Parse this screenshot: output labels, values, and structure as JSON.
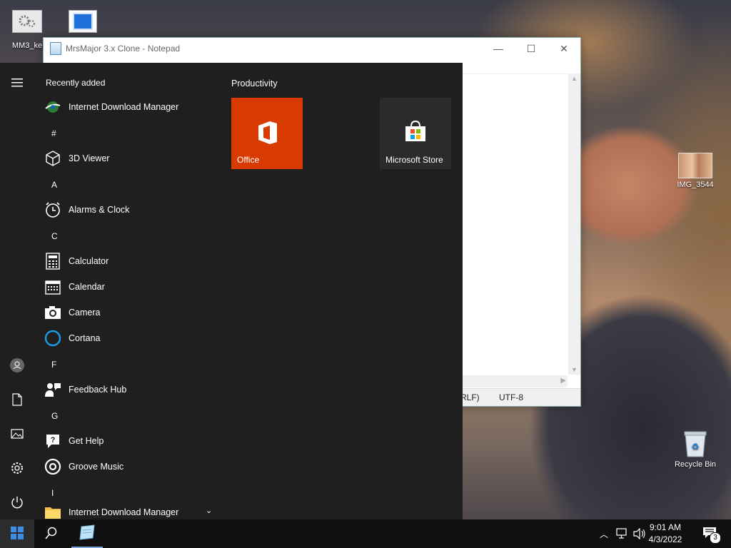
{
  "desktop": {
    "icons": [
      {
        "label": "MM3_ke",
        "name": "mm3-desktop-icon"
      },
      {
        "label": "",
        "name": "notepad-desktop-icon"
      },
      {
        "label": "IMG_3544",
        "name": "img-3544-desktop-icon"
      },
      {
        "label": "Recycle Bin",
        "name": "recycle-bin-desktop-icon"
      }
    ]
  },
  "notepad": {
    "title": "MrsMajor 3.x Clone - Notepad",
    "status": {
      "line_ending": "RLF)",
      "encoding": "UTF-8"
    },
    "controls": {
      "minimize": "—",
      "maximize": "☐",
      "close": "✕"
    }
  },
  "start_menu": {
    "recently_added_header": "Recently added",
    "recent": [
      {
        "label": "Internet Download Manager",
        "icon": "idm-icon"
      }
    ],
    "groups": [
      {
        "letter": "#",
        "apps": [
          {
            "label": "3D Viewer",
            "icon": "cube-icon"
          }
        ]
      },
      {
        "letter": "A",
        "apps": [
          {
            "label": "Alarms & Clock",
            "icon": "alarm-clock-icon"
          }
        ]
      },
      {
        "letter": "C",
        "apps": [
          {
            "label": "Calculator",
            "icon": "calculator-icon"
          },
          {
            "label": "Calendar",
            "icon": "calendar-icon"
          },
          {
            "label": "Camera",
            "icon": "camera-icon"
          },
          {
            "label": "Cortana",
            "icon": "cortana-icon"
          }
        ]
      },
      {
        "letter": "F",
        "apps": [
          {
            "label": "Feedback Hub",
            "icon": "feedback-icon"
          }
        ]
      },
      {
        "letter": "G",
        "apps": [
          {
            "label": "Get Help",
            "icon": "help-icon"
          },
          {
            "label": "Groove Music",
            "icon": "music-icon"
          }
        ]
      },
      {
        "letter": "I",
        "apps": [
          {
            "label": "Internet Download Manager",
            "icon": "folder-icon"
          }
        ]
      }
    ],
    "tiles_group_label": "Productivity",
    "tiles": [
      {
        "label": "Office",
        "icon": "office-icon",
        "color": "#d83b01"
      },
      {
        "label": "Microsoft Store",
        "icon": "store-icon",
        "color": "#2b2b2b"
      }
    ],
    "rail": [
      "hamburger-menu-icon",
      "user-icon",
      "documents-icon",
      "pictures-icon",
      "settings-icon",
      "power-icon"
    ]
  },
  "taskbar": {
    "time": "9:01 AM",
    "date": "4/3/2022",
    "notification_count": "3"
  },
  "colors": {
    "start_bg": "#1f1f1f",
    "taskbar_bg": "#101010",
    "office_tile": "#d83b01",
    "accent_blue": "#0078d7"
  }
}
